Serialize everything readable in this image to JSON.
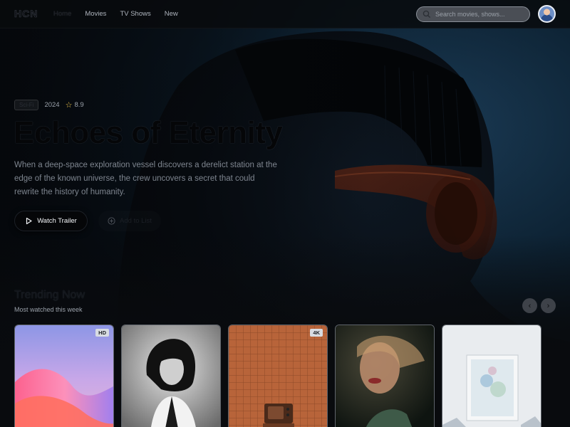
{
  "nav": {
    "logo": "HCN",
    "links": [
      "Home",
      "Movies",
      "TV Shows",
      "New"
    ],
    "active": "Home",
    "search_placeholder": "Search movies, shows..."
  },
  "hero": {
    "genre": "Sci-Fi",
    "year": "2024",
    "rating": "8.9",
    "title": "Echoes of Eternity",
    "description": "When a deep-space exploration vessel discovers a derelict station at the edge of the known universe, the crew uncovers a secret that could rewrite the history of humanity.",
    "watch_label": "Watch Trailer",
    "list_label": "Add to List"
  },
  "trending": {
    "title": "Trending Now",
    "subtitle": "Most watched this week",
    "cards": [
      {
        "badge": "HD"
      },
      {
        "badge": ""
      },
      {
        "badge": "4K"
      },
      {
        "badge": ""
      },
      {
        "badge": ""
      }
    ]
  },
  "colors": {
    "accent": "#f2c94c",
    "background": "#0a0c10"
  },
  "icons": [
    "search-icon",
    "star-icon",
    "play-icon",
    "plus-circle-icon",
    "chevron-left-icon",
    "chevron-right-icon"
  ]
}
